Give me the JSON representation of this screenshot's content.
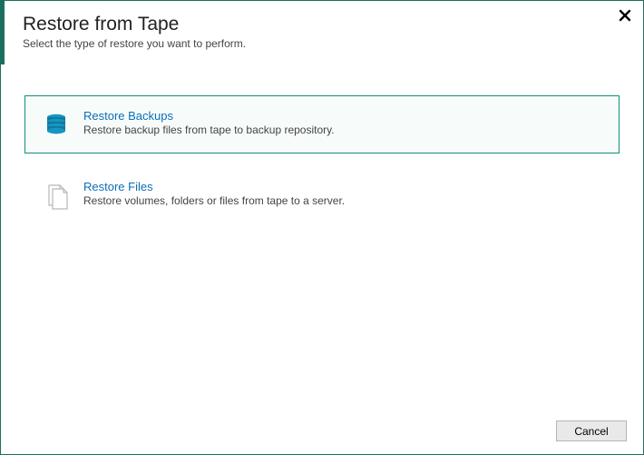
{
  "header": {
    "title": "Restore from Tape",
    "subtitle": "Select the type of restore you want to perform."
  },
  "options": [
    {
      "title": "Restore Backups",
      "desc": "Restore backup files from tape to backup repository.",
      "selected": true,
      "icon": "database-tape-icon"
    },
    {
      "title": "Restore Files",
      "desc": "Restore volumes, folders or files from tape to a server.",
      "selected": false,
      "icon": "files-icon"
    }
  ],
  "footer": {
    "cancel_label": "Cancel"
  },
  "colors": {
    "accent": "#1c6f5e",
    "link": "#0b6fb8"
  }
}
